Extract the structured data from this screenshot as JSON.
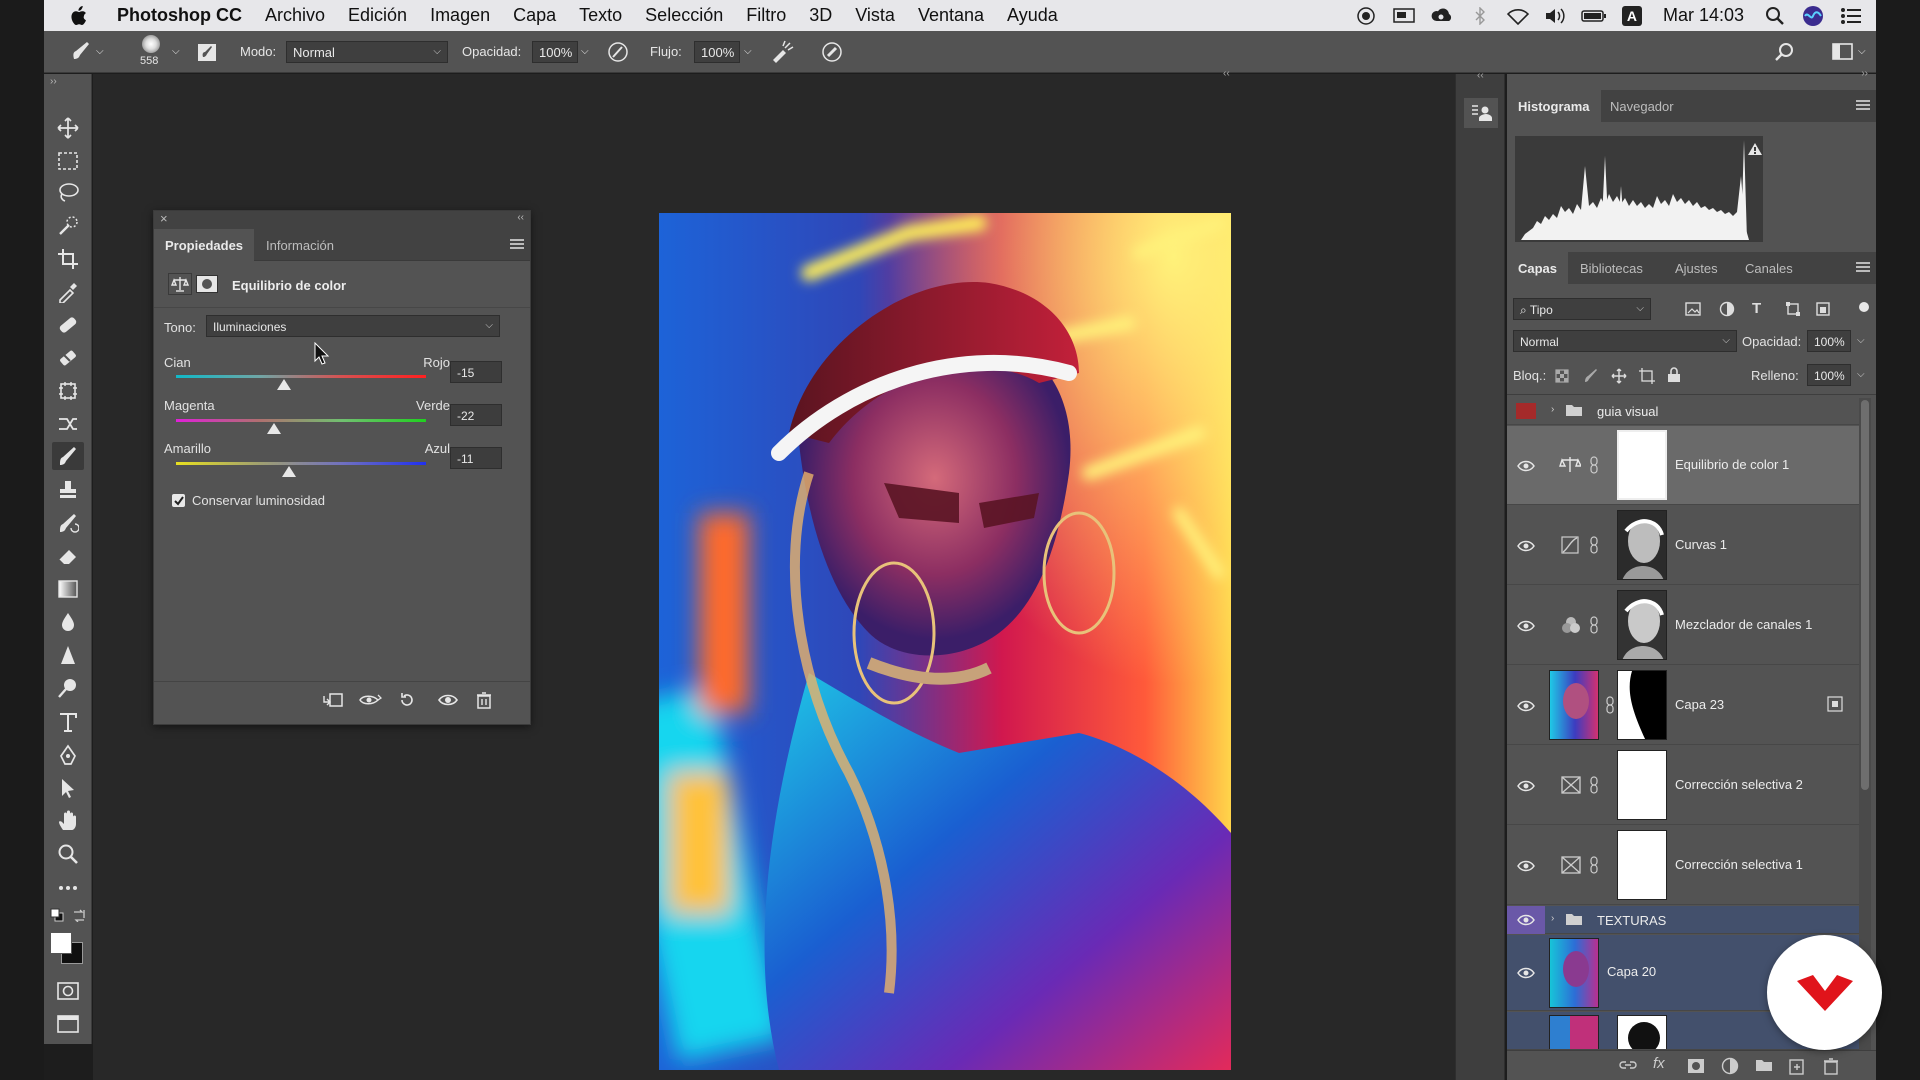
{
  "menubar": {
    "app_name": "Photoshop CC",
    "items": [
      "Archivo",
      "Edición",
      "Imagen",
      "Capa",
      "Texto",
      "Selección",
      "Filtro",
      "3D",
      "Vista",
      "Ventana",
      "Ayuda"
    ],
    "clock": "Mar 14:03",
    "status_icons": [
      "record-icon",
      "display-icon",
      "creative-cloud-icon",
      "bluetooth-icon",
      "wifi-icon",
      "volume-icon",
      "battery-icon",
      "input-source-icon",
      "spotlight-icon",
      "siri-icon",
      "notification-list-icon"
    ],
    "input_source": "A"
  },
  "options_bar": {
    "brush_size": "558",
    "mode_label": "Modo:",
    "mode_value": "Normal",
    "opacity_label": "Opacidad:",
    "opacity_value": "100%",
    "flow_label": "Flujo:",
    "flow_value": "100%"
  },
  "tools": [
    "move-tool-icon",
    "marquee-tool-icon",
    "lasso-tool-icon",
    "quick-select-tool-icon",
    "crop-tool-icon",
    "eyedropper-tool-icon",
    "healing-brush-icon",
    "patch-tool-icon",
    "content-aware-icon",
    "brush-tool-icon",
    "stamp-tool-icon",
    "history-brush-icon",
    "eraser-tool-icon",
    "gradient-tool-icon",
    "blur-tool-icon",
    "sharpen-tool-icon",
    "dodge-tool-icon",
    "type-tool-icon",
    "pen-tool-icon",
    "path-select-tool-icon",
    "hand-tool-icon",
    "zoom-tool-icon",
    "more-tools-icon"
  ],
  "active_tool": "brush-tool-icon",
  "properties_panel": {
    "tabs": [
      "Propiedades",
      "Información"
    ],
    "active_tab": "Propiedades",
    "adjustment_title": "Equilibrio de color",
    "tone_label": "Tono:",
    "tone_value": "Iluminaciones",
    "sliders": [
      {
        "left": "Cian",
        "right": "Rojo",
        "value": "-15",
        "fraction": 0.43
      },
      {
        "left": "Magenta",
        "right": "Verde",
        "value": "-22",
        "fraction": 0.39
      },
      {
        "left": "Amarillo",
        "right": "Azul",
        "value": "-11",
        "fraction": 0.45
      }
    ],
    "preserve_label": "Conservar luminosidad",
    "preserve_checked": true
  },
  "histogram_panel": {
    "tabs": [
      "Histograma",
      "Navegador"
    ],
    "active_tab": "Histograma"
  },
  "layers_panel": {
    "tabs": [
      "Capas",
      "Bibliotecas",
      "Ajustes",
      "Canales"
    ],
    "active_tab": "Capas",
    "filter_value": "Tipo",
    "blend_mode": "Normal",
    "opacity_label": "Opacidad:",
    "opacity_value": "100%",
    "lock_label": "Bloq.:",
    "fill_label": "Relleno:",
    "fill_value": "100%",
    "layers": [
      {
        "name": "guia visual",
        "kind": "group"
      },
      {
        "name": "Equilibrio de color 1",
        "kind": "color-balance",
        "selected": true
      },
      {
        "name": "Curvas 1",
        "kind": "curves"
      },
      {
        "name": "Mezclador de canales 1",
        "kind": "channel-mixer"
      },
      {
        "name": "Capa 23",
        "kind": "pixel"
      },
      {
        "name": "Corrección selectiva 2",
        "kind": "selective"
      },
      {
        "name": "Corrección selectiva 1",
        "kind": "selective"
      },
      {
        "name": "TEXTURAS",
        "kind": "group"
      },
      {
        "name": "Capa 20",
        "kind": "pixel"
      }
    ]
  },
  "colors": {
    "accent_red": "#e0141b",
    "panel_bg": "#535353",
    "menubar_bg": "#e7e7ea"
  }
}
